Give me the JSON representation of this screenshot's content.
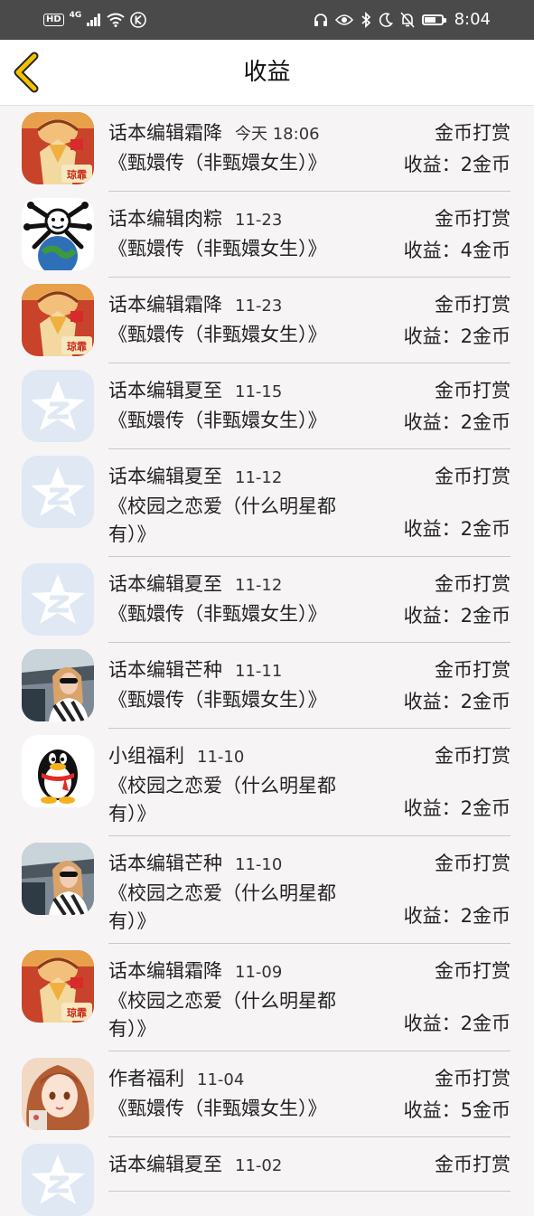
{
  "status_bar": {
    "left": [
      "HD",
      "4G"
    ],
    "time": "8:04"
  },
  "header": {
    "title": "收益",
    "back_icon": "chevron-left-icon"
  },
  "records": [
    {
      "name": "话本编辑霜降",
      "date": "今天 18:06",
      "type": "金币打赏",
      "book": "《甄嬛传（非甄嬛女生）》",
      "earn": "收益：2金币",
      "avatar": "avatar-orange-cartoon"
    },
    {
      "name": "话本编辑肉粽",
      "date": "11-23",
      "type": "金币打赏",
      "book": "《甄嬛传（非甄嬛女生）》",
      "earn": "收益：4金币",
      "avatar": "avatar-globe-meme"
    },
    {
      "name": "话本编辑霜降",
      "date": "11-23",
      "type": "金币打赏",
      "book": "《甄嬛传（非甄嬛女生）》",
      "earn": "收益：2金币",
      "avatar": "avatar-orange-cartoon"
    },
    {
      "name": "话本编辑夏至",
      "date": "11-15",
      "type": "金币打赏",
      "book": "《甄嬛传（非甄嬛女生）》",
      "earn": "收益：2金币",
      "avatar": "avatar-qzone-star"
    },
    {
      "name": "话本编辑夏至",
      "date": "11-12",
      "type": "金币打赏",
      "book": "《校园之恋爱（什么明星都有）》",
      "earn": "收益：2金币",
      "avatar": "avatar-qzone-star"
    },
    {
      "name": "话本编辑夏至",
      "date": "11-12",
      "type": "金币打赏",
      "book": "《甄嬛传（非甄嬛女生）》",
      "earn": "收益：2金币",
      "avatar": "avatar-qzone-star"
    },
    {
      "name": "话本编辑芒种",
      "date": "11-11",
      "type": "金币打赏",
      "book": "《甄嬛传（非甄嬛女生）》",
      "earn": "收益：2金币",
      "avatar": "avatar-photo-girl"
    },
    {
      "name": "小组福利",
      "date": "11-10",
      "type": "金币打赏",
      "book": "《校园之恋爱（什么明星都有）》",
      "earn": "收益：2金币",
      "avatar": "avatar-qq-penguin"
    },
    {
      "name": "话本编辑芒种",
      "date": "11-10",
      "type": "金币打赏",
      "book": "《校园之恋爱（什么明星都有）》",
      "earn": "收益：2金币",
      "avatar": "avatar-photo-girl"
    },
    {
      "name": "话本编辑霜降",
      "date": "11-09",
      "type": "金币打赏",
      "book": "《校园之恋爱（什么明星都有）》",
      "earn": "收益：2金币",
      "avatar": "avatar-orange-cartoon"
    },
    {
      "name": "作者福利",
      "date": "11-04",
      "type": "金币打赏",
      "book": "《甄嬛传（非甄嬛女生）》",
      "earn": "收益：5金币",
      "avatar": "avatar-anime-girl"
    },
    {
      "name": "话本编辑夏至",
      "date": "11-02",
      "type": "金币打赏",
      "book": "",
      "earn": "",
      "avatar": "avatar-qzone-star"
    }
  ]
}
